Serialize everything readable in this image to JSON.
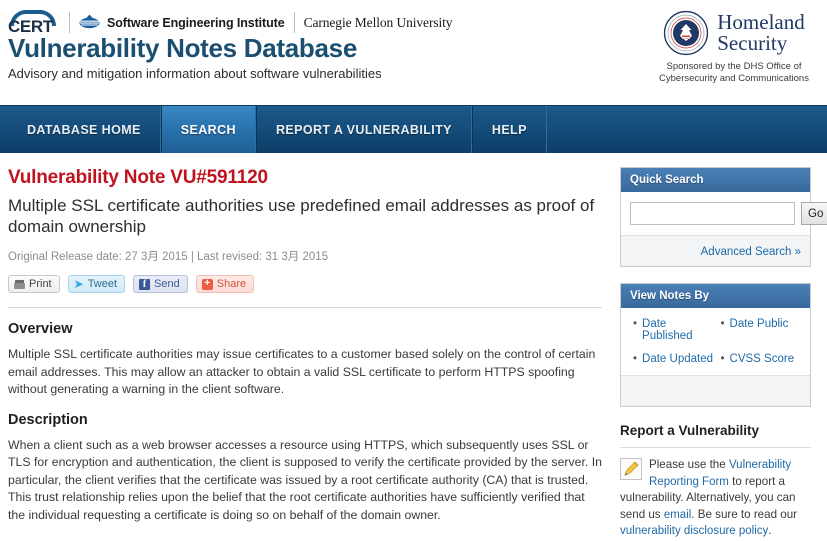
{
  "header": {
    "cert_logo_text": "CERT",
    "sei_text": "Software Engineering Institute",
    "cmu_text": "Carnegie Mellon University",
    "site_title": "Vulnerability Notes Database",
    "site_subtitle": "Advisory and mitigation information about software vulnerabilities",
    "dhs": {
      "line1": "Homeland",
      "line2": "Security",
      "sponsor_line1": "Sponsored by the DHS Office of",
      "sponsor_line2": "Cybersecurity and Communications"
    }
  },
  "nav": {
    "items": [
      {
        "label": "DATABASE HOME",
        "active": false
      },
      {
        "label": "SEARCH",
        "active": true
      },
      {
        "label": "REPORT A VULNERABILITY",
        "active": false
      },
      {
        "label": "HELP",
        "active": false
      }
    ]
  },
  "main": {
    "vu_id": "Vulnerability Note VU#591120",
    "vu_title": "Multiple SSL certificate authorities use predefined email addresses as proof of domain ownership",
    "dates": "Original Release date: 27 3月 2015 | Last revised: 31 3月 2015",
    "share_buttons": [
      {
        "label": "Print",
        "icon": "printer-icon"
      },
      {
        "label": "Tweet",
        "icon": "twitter-bird-icon"
      },
      {
        "label": "Send",
        "icon": "facebook-icon"
      },
      {
        "label": "Share",
        "icon": "plus-share-icon"
      }
    ],
    "sections": [
      {
        "heading": "Overview",
        "text": "Multiple SSL certificate authorities may issue certificates to a customer based solely on the control of certain email addresses. This may allow an attacker to obtain a valid SSL certificate to perform HTTPS spoofing without generating a warning in the client software."
      },
      {
        "heading": "Description",
        "text": "When a client such as a web browser accesses a resource using HTTPS, which subsequently uses SSL or TLS for encryption and authentication, the client is supposed to verify the certificate provided by the server. In particular, the client verifies that the certificate was issued by a root certificate authority (CA) that is trusted. This trust relationship relies upon the belief that the root certificate authorities have sufficiently verified that the individual requesting a certificate is doing so on behalf of the domain owner."
      }
    ]
  },
  "sidebar": {
    "quick_search": {
      "title": "Quick Search",
      "input_value": "",
      "input_placeholder": "",
      "go_label": "Go",
      "advanced_label": "Advanced Search »"
    },
    "view_notes_by": {
      "title": "View Notes By",
      "links": [
        "Date Published",
        "Date Public",
        "Date Updated",
        "CVSS Score"
      ]
    },
    "report": {
      "title": "Report a Vulnerability",
      "t1": "Please use the ",
      "l1": "Vulnerability Reporting Form",
      "t2": " to report a vulnerability. Alternatively, you can send us ",
      "l2": "email",
      "t3": ". Be sure to read our ",
      "l3": "vulnerability disclosure policy",
      "t4": "."
    }
  },
  "colors": {
    "nav_dark": "#0c3e68",
    "nav_active": "#2a74b0",
    "accent_red": "#c1121f",
    "link_blue": "#1f6aa8",
    "title_blue": "#1b4f72",
    "box_header": "#38699c"
  }
}
